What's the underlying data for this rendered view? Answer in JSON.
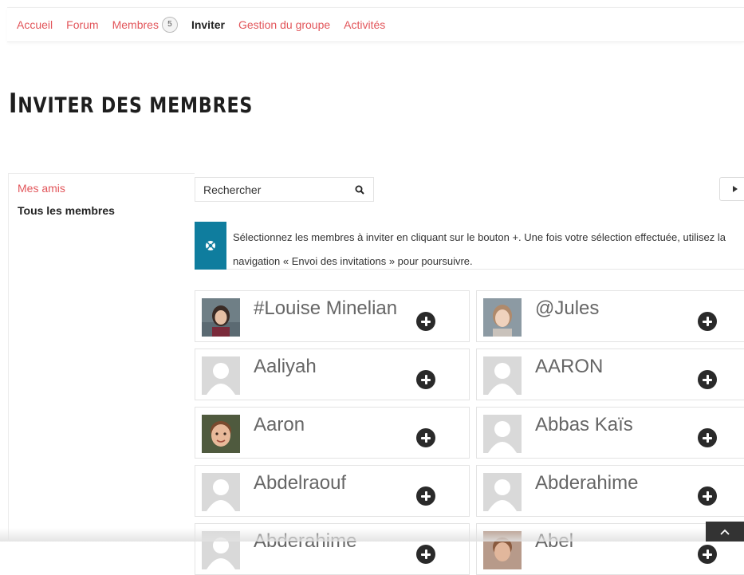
{
  "nav": {
    "items": [
      {
        "label": "Accueil"
      },
      {
        "label": "Forum"
      },
      {
        "label": "Membres",
        "badge": "5"
      },
      {
        "label": "Inviter",
        "active": true
      },
      {
        "label": "Gestion du groupe"
      },
      {
        "label": "Activités"
      }
    ]
  },
  "page": {
    "title_cap": "I",
    "title_rest": "nviter des membres"
  },
  "sidebar": {
    "items": [
      {
        "label": "Mes amis"
      },
      {
        "label": "Tous les membres"
      }
    ]
  },
  "search": {
    "placeholder": "Rechercher",
    "icon": "search-icon"
  },
  "notice": {
    "text": "Sélectionnez les membres à inviter en cliquant sur le bouton +. Une fois votre sélection effectuée, utilisez la navigation « Envoi des invitations » pour poursuivre.",
    "icon": "support-icon",
    "icon_bg": "#0f7d9e"
  },
  "members": [
    {
      "name": "#Louise Minelian",
      "avatar": "photo"
    },
    {
      "name": "@Jules",
      "avatar": "photo"
    },
    {
      "name": "Aaliyah",
      "avatar": "default"
    },
    {
      "name": "AARON",
      "avatar": "default"
    },
    {
      "name": "Aaron",
      "avatar": "photo"
    },
    {
      "name": "Abbas Kaïs",
      "avatar": "default"
    },
    {
      "name": "Abdelraouf",
      "avatar": "default"
    },
    {
      "name": "Abderahime",
      "avatar": "default"
    },
    {
      "name": "Abderahime",
      "avatar": "default"
    },
    {
      "name": "Abel",
      "avatar": "photo"
    }
  ],
  "colors": {
    "accent": "#e2555a",
    "text": "#333333",
    "add_button": "#2a2a2a"
  }
}
